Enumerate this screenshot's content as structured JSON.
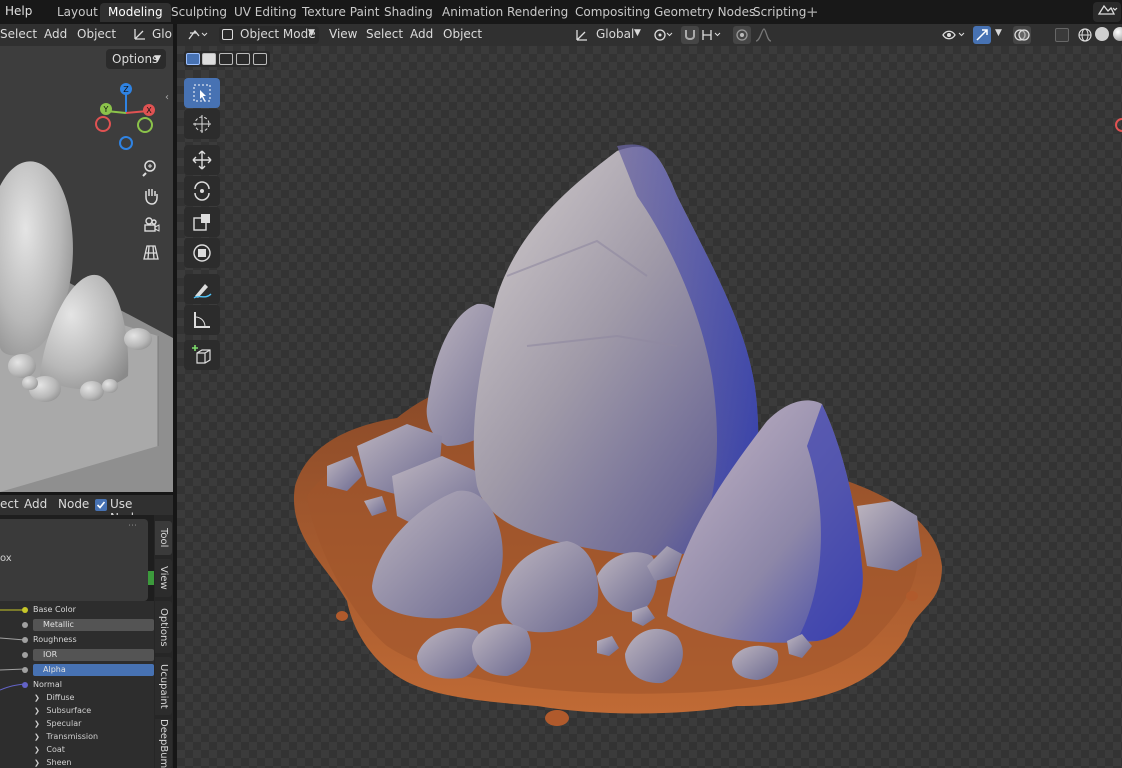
{
  "topbar": {
    "help": "Help",
    "tabs": [
      "Layout",
      "Modeling",
      "Sculpting",
      "UV Editing",
      "Texture Paint",
      "Shading",
      "Animation",
      "Rendering",
      "Compositing",
      "Geometry Nodes",
      "Scripting"
    ],
    "active_tab": "Modeling",
    "add_tab": "+"
  },
  "left_view": {
    "menu": [
      "Select",
      "Add",
      "Object"
    ],
    "orientation": "Glob",
    "options": "Options",
    "gizmo": {
      "z": "Z",
      "y": "Y",
      "x": "X"
    }
  },
  "node_editor": {
    "menu": [
      "ect",
      "Add",
      "Node"
    ],
    "use_nodes_label": "Use Nodes",
    "use_nodes_checked": true,
    "node_partial_label": "ox",
    "inputs": [
      {
        "label": "Base Color",
        "color": "#c7c729",
        "field": false
      },
      {
        "label": "Metallic",
        "color": "#a1a1a1",
        "field": true,
        "selected": false
      },
      {
        "label": "Roughness",
        "color": "#a1a1a1",
        "field": false
      },
      {
        "label": "IOR",
        "color": "#a1a1a1",
        "field": true,
        "selected": false
      },
      {
        "label": "Alpha",
        "color": "#a1a1a1",
        "field": true,
        "selected": true
      },
      {
        "label": "Normal",
        "color": "#6363c7",
        "field": false
      }
    ],
    "subpanels": [
      "Diffuse",
      "Subsurface",
      "Specular",
      "Transmission",
      "Coat",
      "Sheen"
    ],
    "side_tabs": [
      "Tool",
      "View",
      "Options",
      "Ucupaint",
      "DeepBum"
    ]
  },
  "main_view": {
    "menu": [
      "View",
      "Select",
      "Add",
      "Object"
    ],
    "mode": "Object Mode",
    "orientation": "Global"
  },
  "colors": {
    "accent": "#4772b3",
    "header": "#303030",
    "topbar": "#181818"
  }
}
